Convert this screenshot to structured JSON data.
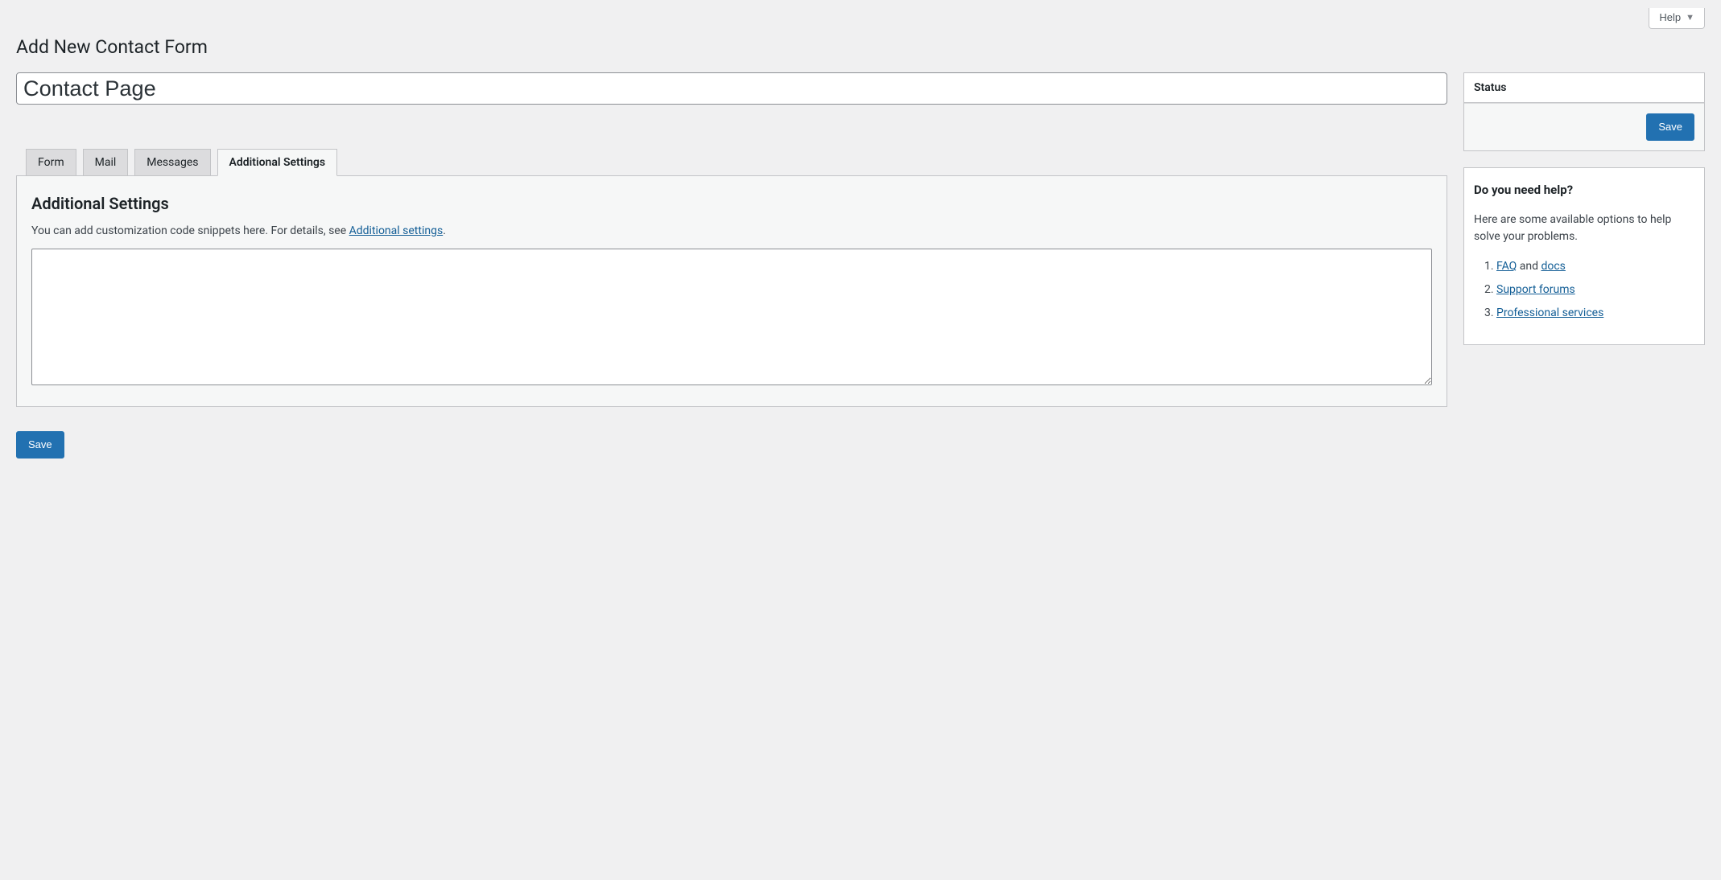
{
  "topbar": {
    "help_label": "Help"
  },
  "page_title": "Add New Contact Form",
  "title_field": {
    "value": "Contact Page"
  },
  "tabs": {
    "form": "Form",
    "mail": "Mail",
    "messages": "Messages",
    "additional": "Additional Settings"
  },
  "panel": {
    "heading": "Additional Settings",
    "description_prefix": "You can add customization code snippets here. For details, see ",
    "description_link": "Additional settings",
    "description_suffix": ".",
    "textarea_value": ""
  },
  "actions": {
    "save": "Save"
  },
  "sidebar": {
    "status": {
      "title": "Status"
    },
    "help": {
      "title": "Do you need help?",
      "intro": "Here are some available options to help solve your problems.",
      "items": {
        "faq": "FAQ",
        "and": " and ",
        "docs": "docs",
        "support": "Support forums",
        "pro": "Professional services"
      }
    }
  }
}
